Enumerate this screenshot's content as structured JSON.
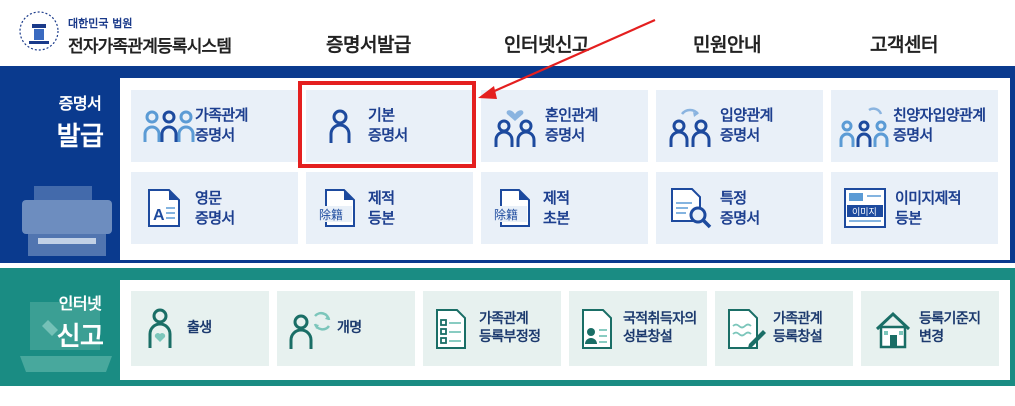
{
  "header": {
    "org": "대한민국 법원",
    "system_name": "전자가족관계등록시스템",
    "nav": [
      "증명서발급",
      "인터넷신고",
      "민원안내",
      "고객센터"
    ]
  },
  "sections": {
    "certificate": {
      "label_small": "증명서",
      "label_big": "발급",
      "tiles": [
        {
          "line1": "가족관계",
          "line2": "증명서",
          "icon": "family-icon"
        },
        {
          "line1": "기본",
          "line2": "증명서",
          "icon": "person-icon"
        },
        {
          "line1": "혼인관계",
          "line2": "증명서",
          "icon": "marriage-icon"
        },
        {
          "line1": "입양관계",
          "line2": "증명서",
          "icon": "adoption-icon"
        },
        {
          "line1": "친양자입양관계",
          "line2": "증명서",
          "icon": "full-adoption-icon"
        },
        {
          "line1": "영문",
          "line2": "증명서",
          "icon": "english-document-icon"
        },
        {
          "line1": "제적",
          "line2": "등본",
          "icon": "removed-register-icon",
          "badge": "除籍"
        },
        {
          "line1": "제적",
          "line2": "초본",
          "icon": "removed-register-icon",
          "badge": "除籍"
        },
        {
          "line1": "특정",
          "line2": "증명서",
          "icon": "search-document-icon"
        },
        {
          "line1": "이미지제적",
          "line2": "등본",
          "icon": "image-register-icon",
          "badge": "이미지"
        }
      ]
    },
    "report": {
      "label_small": "인터넷",
      "label_big": "신고",
      "tiles": [
        {
          "line1": "출생",
          "line2": "",
          "icon": "birth-icon"
        },
        {
          "line1": "개명",
          "line2": "",
          "icon": "rename-icon"
        },
        {
          "line1": "가족관계",
          "line2": "등록부정정",
          "icon": "checklist-icon"
        },
        {
          "line1": "국적취득자의",
          "line2": "성본창설",
          "icon": "id-document-icon"
        },
        {
          "line1": "가족관계",
          "line2": "등록창설",
          "icon": "edit-document-icon"
        },
        {
          "line1": "등록기준지",
          "line2": "변경",
          "icon": "house-icon"
        }
      ]
    }
  },
  "colors": {
    "certificate_band": "#0a3a8e",
    "report_band": "#1a8c83",
    "highlight": "#e41f1f"
  }
}
